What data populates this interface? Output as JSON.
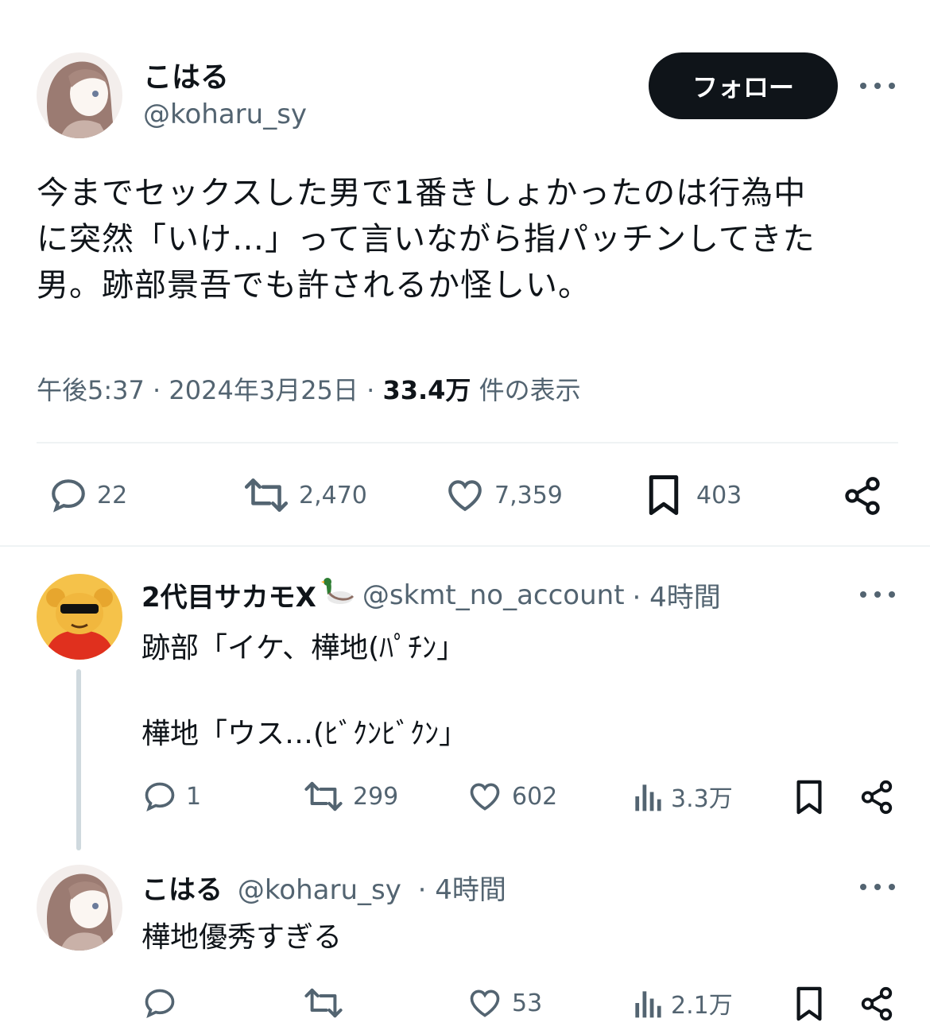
{
  "main_tweet": {
    "name": "こはる",
    "handle": "@koharu_sy",
    "follow_label": "フォロー",
    "text_lines": [
      "今までセックスした男で1番きしょかったのは行為中",
      "に突然「いけ…」って言いながら指パッチンしてきた",
      "男。跡部景吾でも許されるか怪しい。"
    ],
    "time": "午後5:37",
    "date": "2024年3月25日",
    "sep": "·",
    "views_count": "33.4万",
    "views_label": "件の表示",
    "stats": {
      "replies": "22",
      "retweets": "2,470",
      "likes": "7,359",
      "bookmarks": "403"
    }
  },
  "reply1": {
    "name": "2代目サカモX",
    "handle": "@skmt_no_account",
    "time": "· 4時間",
    "line1": "跡部「イケ、樺地(ﾊﾟﾁﾝ」",
    "line2": "樺地「ウス…(ﾋﾞｸﾝﾋﾞｸﾝ」",
    "stats": {
      "replies": "1",
      "retweets": "299",
      "likes": "602",
      "views": "3.3万"
    }
  },
  "reply2": {
    "name": "こはる",
    "handle": "@koharu_sy",
    "time": "· 4時間",
    "text": "樺地優秀すぎる",
    "stats": {
      "likes": "53",
      "views": "2.1万"
    }
  },
  "colors": {
    "text": "#0f1419",
    "secondary": "#536471",
    "divider": "#eff3f4"
  },
  "icons": [
    "reply-icon",
    "retweet-icon",
    "like-icon",
    "bookmark-icon",
    "share-icon",
    "views-icon",
    "more-icon",
    "duck-emoji"
  ]
}
